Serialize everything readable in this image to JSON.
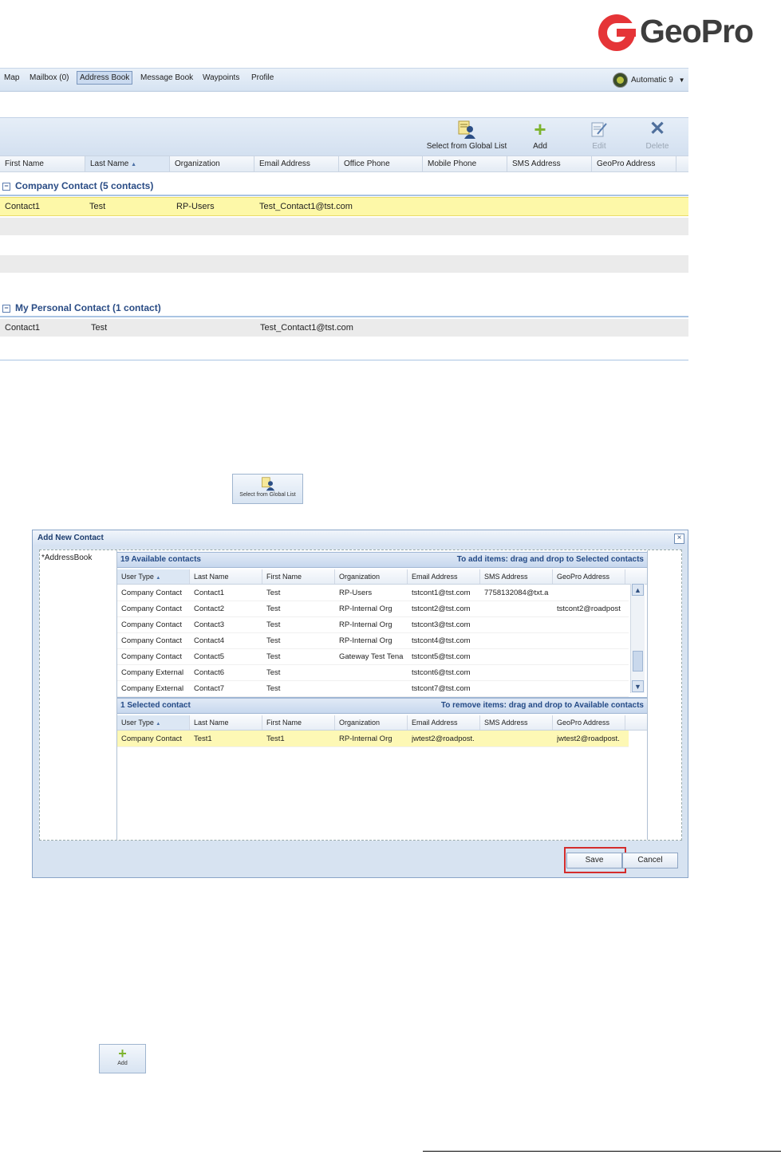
{
  "brand": {
    "logo_text": "GeoPro",
    "logo_color": "#e53437"
  },
  "nav": {
    "items": [
      "Map",
      "Mailbox (0)",
      "Address Book",
      "Message Book",
      "Waypoints",
      "Profile"
    ],
    "active": "Address Book",
    "account_label": "Automatic 9",
    "account_icon": "status-globe-icon"
  },
  "toolbar": {
    "select_global": "Select from Global List",
    "add": "Add",
    "edit": "Edit",
    "delete": "Delete"
  },
  "address_book": {
    "columns": [
      "First Name",
      "Last Name",
      "Organization",
      "Email Address",
      "Office Phone",
      "Mobile Phone",
      "SMS Address",
      "GeoPro Address"
    ],
    "company_group": {
      "title": "Company Contact (5 contacts)",
      "rows": [
        {
          "first": "Contact1",
          "last": "Test",
          "org": "RP-Users",
          "email": "Test_Contact1@tst.com"
        }
      ]
    },
    "personal_group": {
      "title": "My Personal Contact (1 contact)",
      "rows": [
        {
          "first": "Contact1",
          "last": "Test",
          "org": "",
          "email": "Test_Contact1@tst.com"
        }
      ]
    }
  },
  "standalone_buttons": {
    "select_global": "Select from Global List",
    "add": "Add"
  },
  "dialog": {
    "title": "Add New Contact",
    "tree_item": "*AddressBook",
    "available": {
      "header_left": "19 Available contacts",
      "header_right": "To add items: drag and drop to Selected contacts",
      "columns": [
        "User Type",
        "Last Name",
        "First Name",
        "Organization",
        "Email Address",
        "SMS Address",
        "GeoPro Address"
      ],
      "rows": [
        [
          "Company Contact",
          "Contact1",
          "Test",
          "RP-Users",
          "tstcont1@tst.com",
          "7758132084@txt.a",
          ""
        ],
        [
          "Company Contact",
          "Contact2",
          "Test",
          "RP-Internal Org",
          "tstcont2@tst.com",
          "",
          "tstcont2@roadpost"
        ],
        [
          "Company Contact",
          "Contact3",
          "Test",
          "RP-Internal Org",
          "tstcont3@tst.com",
          "",
          ""
        ],
        [
          "Company Contact",
          "Contact4",
          "Test",
          "RP-Internal Org",
          "tstcont4@tst.com",
          "",
          ""
        ],
        [
          "Company Contact",
          "Contact5",
          "Test",
          "Gateway Test Tena",
          "tstcont5@tst.com",
          "",
          ""
        ],
        [
          "Company External",
          "Contact6",
          "Test",
          "",
          "tstcont6@tst.com",
          "",
          ""
        ],
        [
          "Company External",
          "Contact7",
          "Test",
          "",
          "tstcont7@tst.com",
          "",
          ""
        ]
      ]
    },
    "selected": {
      "header_left": "1 Selected contact",
      "header_right": "To remove items: drag and drop to Available contacts",
      "columns": [
        "User Type",
        "Last Name",
        "First Name",
        "Organization",
        "Email Address",
        "SMS Address",
        "GeoPro Address"
      ],
      "rows": [
        [
          "Company Contact",
          "Test1",
          "Test1",
          "RP-Internal Org",
          "jwtest2@roadpost.",
          "",
          "jwtest2@roadpost."
        ]
      ]
    },
    "save": "Save",
    "cancel": "Cancel"
  }
}
